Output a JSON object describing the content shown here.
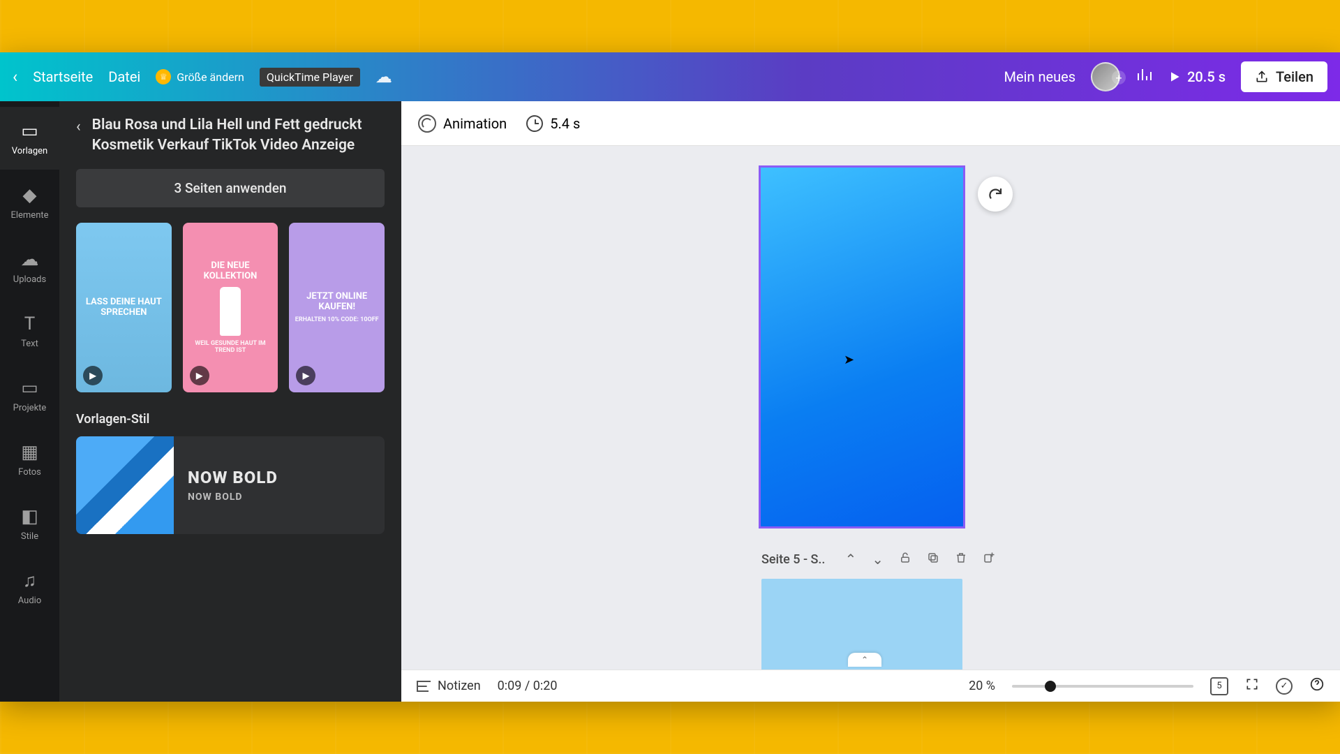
{
  "topbar": {
    "home": "Startseite",
    "file": "Datei",
    "resize": "Größe ändern",
    "tooltip": "QuickTime Player",
    "project_title": "Mein neues",
    "play_duration": "20.5 s",
    "share": "Teilen"
  },
  "rail": {
    "templates": "Vorlagen",
    "elements": "Elemente",
    "uploads": "Uploads",
    "text": "Text",
    "projects": "Projekte",
    "photos": "Fotos",
    "styles": "Stile",
    "audio": "Audio"
  },
  "panel": {
    "template_title": "Blau Rosa und Lila Hell und Fett gedruckt Kosmetik Verkauf TikTok Video Anzeige",
    "apply_pages": "3 Seiten anwenden",
    "thumb1_text": "LASS DEINE HAUT SPRECHEN",
    "thumb2_text": "DIE NEUE KOLLEKTION",
    "thumb2_sub": "WEIL GESUNDE HAUT IM TREND IST",
    "thumb3_text": "JETZT ONLINE KAUFEN!",
    "thumb3_sub": "ERHALTEN 10% CODE: 10OFF",
    "style_section": "Vorlagen-Stil",
    "style_name_big": "NOW BOLD",
    "style_name_small": "NOW BOLD"
  },
  "context": {
    "animation": "Animation",
    "clip_time": "5.4 s"
  },
  "page_controls": {
    "page_label": "Seite 5 - S.."
  },
  "footer": {
    "notes": "Notizen",
    "timecode": "0:09 / 0:20",
    "zoom": "20 %",
    "zoom_fraction": 0.18,
    "page_count": "5"
  }
}
